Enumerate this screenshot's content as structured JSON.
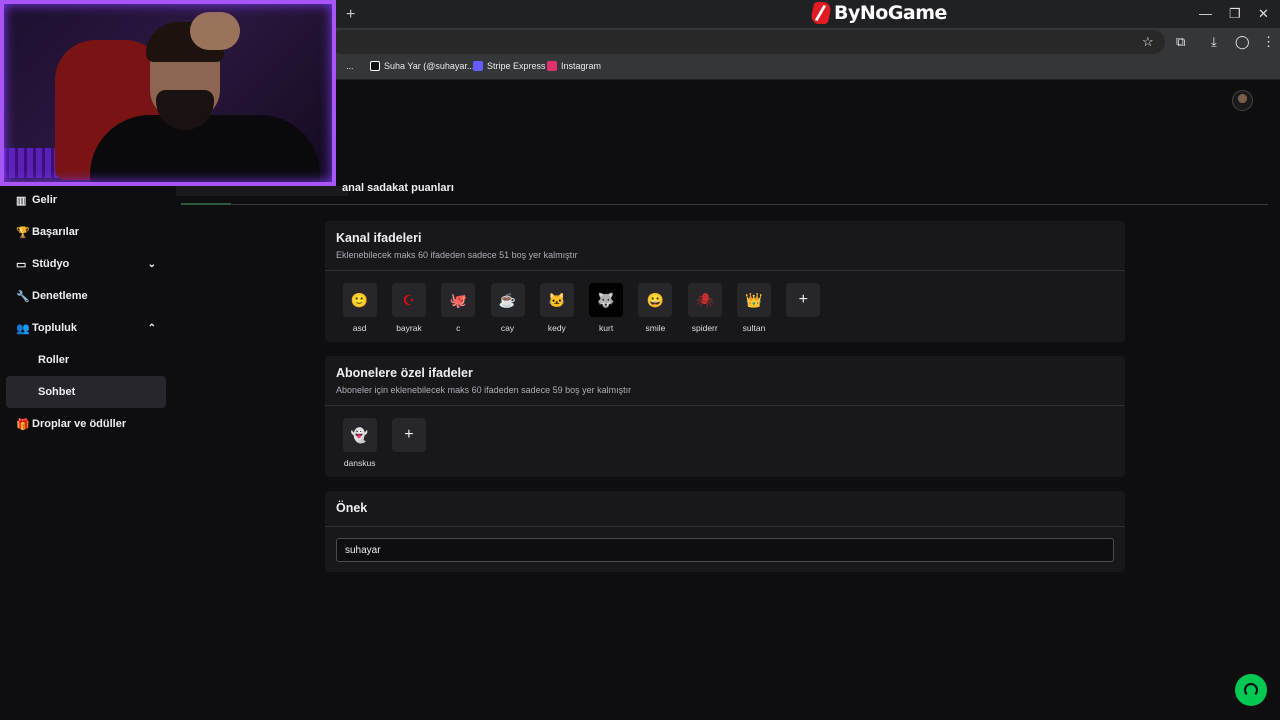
{
  "browser": {
    "new_tab": "+",
    "brand": "ByNoGame",
    "window_controls": [
      "—",
      "❐",
      "✕"
    ],
    "toolbar_icons": [
      "☆",
      "⧉",
      "⤓",
      "◯",
      "⋮"
    ],
    "bookmarks": [
      {
        "label": "...",
        "color": "#888888"
      },
      {
        "label": "Suha Yar (@suhayar....",
        "color": "#111111"
      },
      {
        "label": "Stripe Express",
        "color": "#635bff"
      },
      {
        "label": "Instagram",
        "color": "#e1306c"
      }
    ]
  },
  "sidebar": {
    "items": [
      {
        "label": "Gelir",
        "icon": "▥"
      },
      {
        "label": "Başarılar",
        "icon": "🏆"
      },
      {
        "label": "Stüdyo",
        "icon": "▭",
        "chevron": "⌄"
      },
      {
        "label": "Denetleme",
        "icon": "🔧"
      },
      {
        "label": "Topluluk",
        "icon": "👥",
        "chevron": "⌃"
      },
      {
        "label": "Roller"
      },
      {
        "label": "Sohbet"
      },
      {
        "label": "Droplar ve ödüller",
        "icon": "🎁"
      }
    ]
  },
  "main": {
    "section_title": "anal sadakat puanları",
    "channel_emotes": {
      "title": "Kanal ifadeleri",
      "subtitle": "Eklenebilecek maks 60 ifadeden sadece 51 boş yer kalmıştır",
      "items": [
        {
          "label": "asd",
          "glyph": "🙂"
        },
        {
          "label": "bayrak",
          "glyph": "☪"
        },
        {
          "label": "c",
          "glyph": "🐙"
        },
        {
          "label": "cay",
          "glyph": "☕"
        },
        {
          "label": "kedy",
          "glyph": "🐱"
        },
        {
          "label": "kurt",
          "glyph": "🐺"
        },
        {
          "label": "smile",
          "glyph": "😀"
        },
        {
          "label": "spiderr",
          "glyph": "🕷"
        },
        {
          "label": "sultan",
          "glyph": "👑"
        }
      ],
      "add": "+"
    },
    "sub_emotes": {
      "title": "Abonelere özel ifadeler",
      "subtitle": "Aboneler için eklenebilecek maks 60 ifadeden sadece 59 boş yer kalmıştır",
      "items": [
        {
          "label": "danskus",
          "glyph": "👻"
        }
      ],
      "add": "+"
    },
    "prefix": {
      "title": "Önek",
      "value": "suhayar"
    }
  }
}
